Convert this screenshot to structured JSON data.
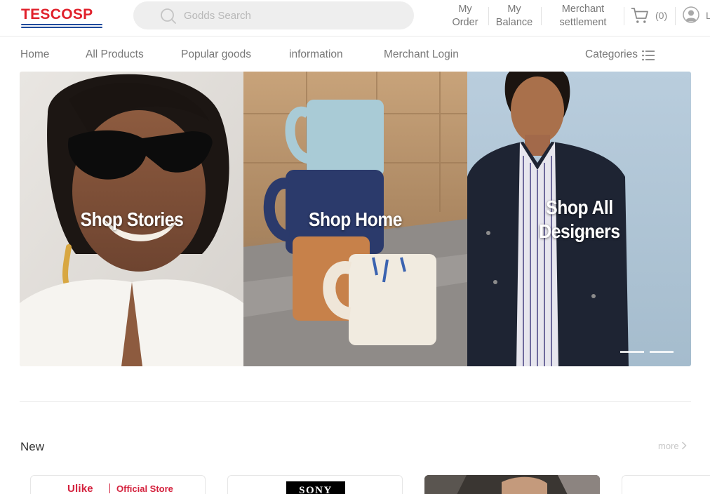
{
  "header": {
    "logo_text": "TESCOSP",
    "search": {
      "placeholder": "Godds Search",
      "value": ""
    },
    "links": [
      {
        "line1": "My",
        "line2": "Order"
      },
      {
        "line1": "My",
        "line2": "Balance"
      },
      {
        "line1": "Merchant",
        "line2": "settlement"
      }
    ],
    "cart_count": "(0)",
    "user_label": "L"
  },
  "nav": {
    "items": [
      "Home",
      "All Products",
      "Popular goods",
      "information",
      "Merchant Login"
    ],
    "categories_label": "Categories"
  },
  "banner": {
    "panels": [
      {
        "title": "Shop Stories"
      },
      {
        "title": "Shop Home"
      },
      {
        "title_line1": "Shop All",
        "title_line2": "Designers"
      }
    ],
    "slide_count": 2
  },
  "new_section": {
    "title": "New",
    "more_label": "more",
    "stores": [
      {
        "brand": "Ulike",
        "label": "Official Store"
      },
      {
        "brand": "SONY"
      }
    ]
  },
  "colors": {
    "brand_red": "#e0202b",
    "brand_blue": "#1f4a9c",
    "text_muted": "#777777",
    "search_bg": "#eeeeee"
  },
  "icons": [
    "search-icon",
    "cart-icon",
    "user-icon",
    "list-icon",
    "chevron-right-icon"
  ]
}
